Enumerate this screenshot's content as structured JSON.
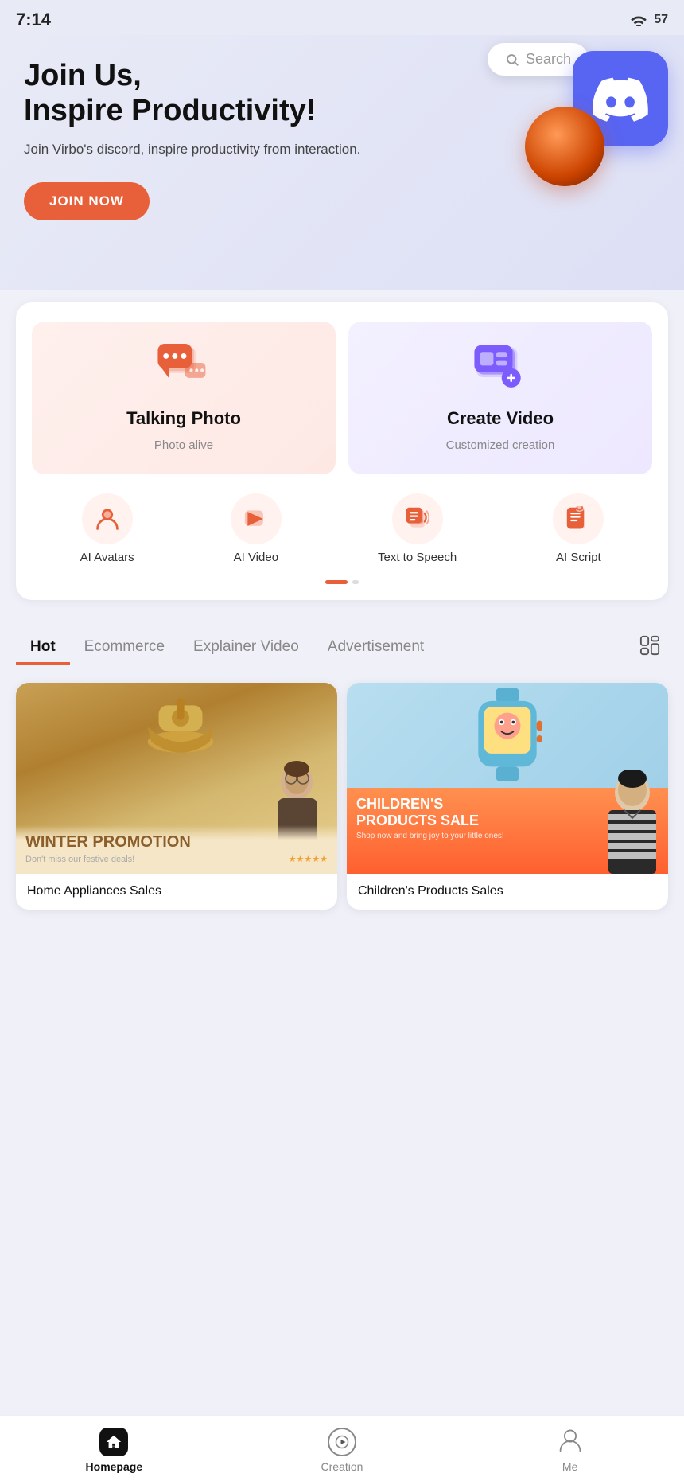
{
  "statusBar": {
    "time": "7:14",
    "icons": "57"
  },
  "hero": {
    "title": "Join Us,\nInspire Productivity!",
    "subtitle": "Join Virbo's discord, inspire productivity from interaction.",
    "joinButton": "JOIN NOW",
    "searchPlaceholder": "Search"
  },
  "featureCards": [
    {
      "id": "talking-photo",
      "title": "Talking Photo",
      "subtitle": "Photo alive",
      "theme": "pink",
      "icon": "💬"
    },
    {
      "id": "create-video",
      "title": "Create Video",
      "subtitle": "Customized creation",
      "theme": "purple",
      "icon": "🎬"
    }
  ],
  "smallFeatures": [
    {
      "id": "ai-avatars",
      "label": "AI Avatars",
      "icon": "👤"
    },
    {
      "id": "ai-video",
      "label": "AI Video",
      "icon": "▲"
    },
    {
      "id": "text-to-speech",
      "label": "Text to Speech",
      "icon": "📊"
    },
    {
      "id": "ai-script",
      "label": "AI Script",
      "icon": "📋"
    }
  ],
  "categoryTabs": [
    {
      "label": "Hot",
      "active": true
    },
    {
      "label": "Ecommerce",
      "active": false
    },
    {
      "label": "Explainer Video",
      "active": false
    },
    {
      "label": "Advertisement",
      "active": false
    }
  ],
  "videoCards": [
    {
      "id": "home-appliances",
      "title": "Winter Promotion",
      "subtitle": "Don't miss our festive deals!",
      "label": "Home Appliances Sales",
      "stars": "★★★★★",
      "type": "winter"
    },
    {
      "id": "children-products",
      "title": "CHILDREN'S PRODUCTS SALE",
      "subtitle": "Shop now and bring joy to your little ones!",
      "label": "Children's Products Sales",
      "type": "children"
    }
  ],
  "bottomNav": [
    {
      "id": "homepage",
      "label": "Homepage",
      "icon": "home",
      "active": true
    },
    {
      "id": "creation",
      "label": "Creation",
      "icon": "play",
      "active": false
    },
    {
      "id": "me",
      "label": "Me",
      "icon": "person",
      "active": false
    }
  ],
  "colors": {
    "accent": "#e8603a",
    "purple": "#7c5cfc",
    "dark": "#111111"
  }
}
